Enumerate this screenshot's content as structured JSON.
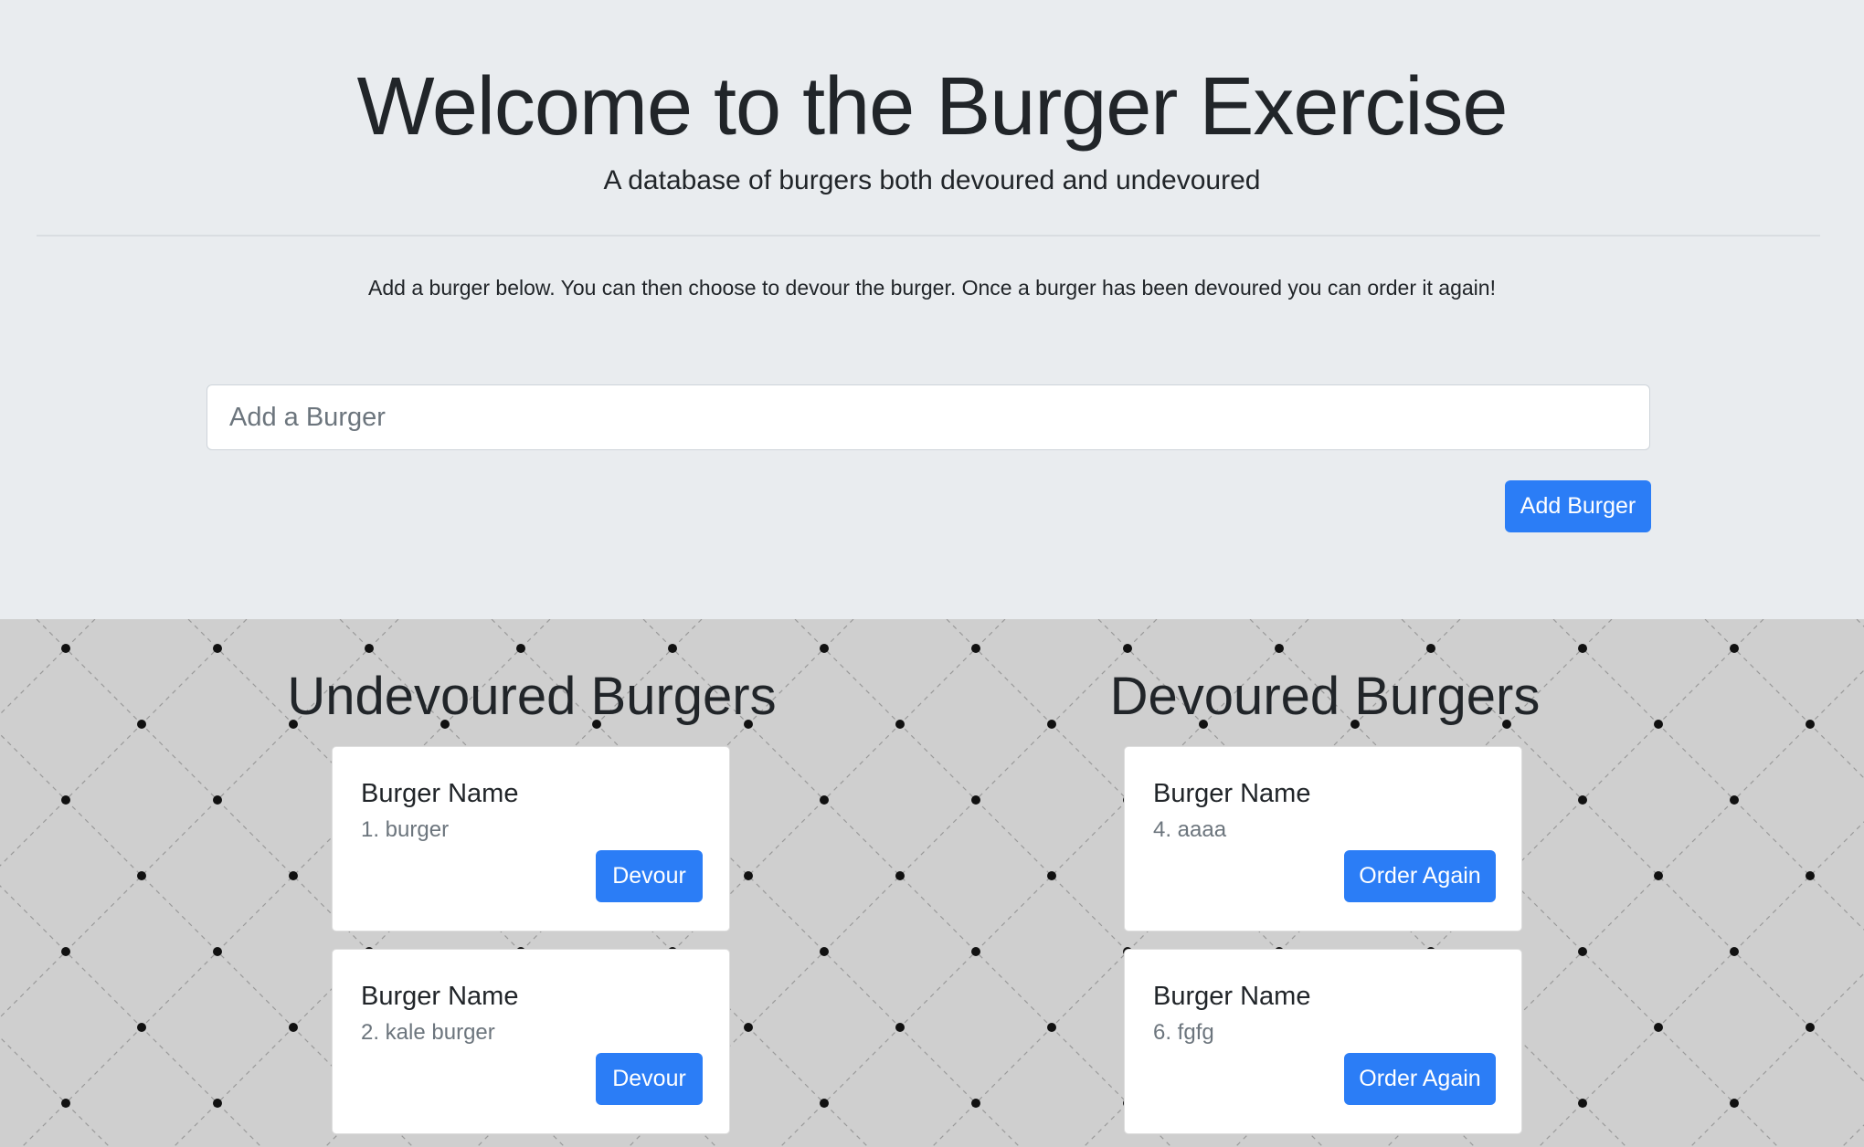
{
  "header": {
    "title": "Welcome to the Burger Exercise",
    "subtitle": "A database of burgers both devoured and undevoured",
    "instructions": "Add a burger below. You can then choose to devour the burger. Once a burger has been devoured you can order it again!"
  },
  "form": {
    "placeholder": "Add a Burger",
    "value": "",
    "submit_label": "Add Burger"
  },
  "colors": {
    "primary": "#2b7df6",
    "jumbotron": "#e9ecef",
    "pattern_bg": "#cfcfcf"
  },
  "undevoured": {
    "heading": "Undevoured Burgers",
    "items": [
      {
        "title": "Burger Name",
        "subtitle": "1. burger",
        "action": "Devour"
      },
      {
        "title": "Burger Name",
        "subtitle": "2. kale burger",
        "action": "Devour"
      }
    ]
  },
  "devoured": {
    "heading": "Devoured Burgers",
    "items": [
      {
        "title": "Burger Name",
        "subtitle": "4. aaaa",
        "action": "Order Again"
      },
      {
        "title": "Burger Name",
        "subtitle": "6. fgfg",
        "action": "Order Again"
      }
    ]
  }
}
